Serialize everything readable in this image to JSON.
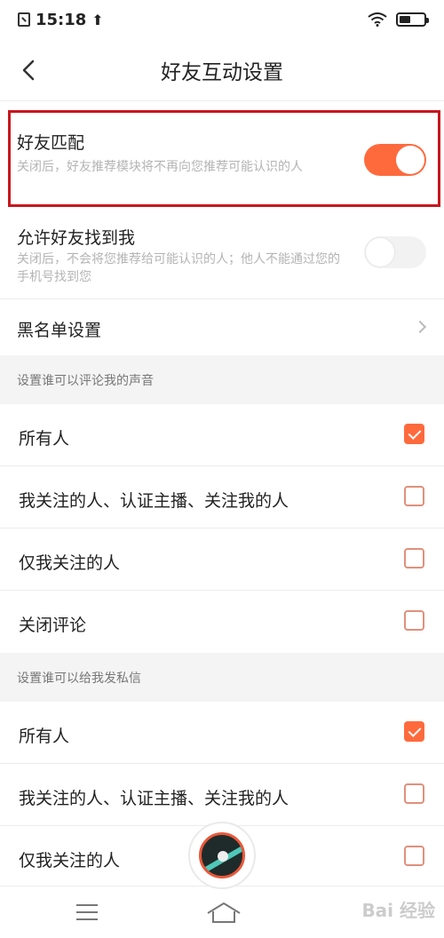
{
  "status_bar": {
    "time": "15:18",
    "upload_glyph": "⬆",
    "icons": [
      "sim-icon",
      "upload-icon",
      "wifi-icon",
      "battery-icon"
    ]
  },
  "nav": {
    "title": "好友互动设置",
    "back_icon": "back-chevron-icon"
  },
  "settings": {
    "friend_match": {
      "label": "好友匹配",
      "description": "关闭后，好友推荐模块将不再向您推荐可能认识的人",
      "enabled": true
    },
    "allow_find": {
      "label": "允许好友找到我",
      "description": "关闭后，不会将您推荐给可能认识的人；他人不能通过您的手机号找到您",
      "enabled": false
    },
    "blacklist": {
      "label": "黑名单设置"
    }
  },
  "comment_section": {
    "header": "设置谁可以评论我的声音",
    "options": [
      {
        "label": "所有人",
        "checked": true
      },
      {
        "label": "我关注的人、认证主播、关注我的人",
        "checked": false
      },
      {
        "label": "仅我关注的人",
        "checked": false
      },
      {
        "label": "关闭评论",
        "checked": false
      }
    ]
  },
  "message_section": {
    "header": "设置谁可以给我发私信",
    "options": [
      {
        "label": "所有人",
        "checked": true
      },
      {
        "label": "我关注的人、认证主播、关注我的人",
        "checked": false
      },
      {
        "label": "仅我关注的人",
        "checked": false
      }
    ]
  },
  "bottom_bar": {
    "icons": [
      "menu-icon",
      "home-icon",
      "player-disc-icon"
    ]
  },
  "watermark": "Bai 经验",
  "colors": {
    "accent": "#ff6a3d",
    "highlight_border": "#c8161d",
    "toggle_off": "#f2f2f2",
    "section_bg": "#f4f4f4"
  }
}
